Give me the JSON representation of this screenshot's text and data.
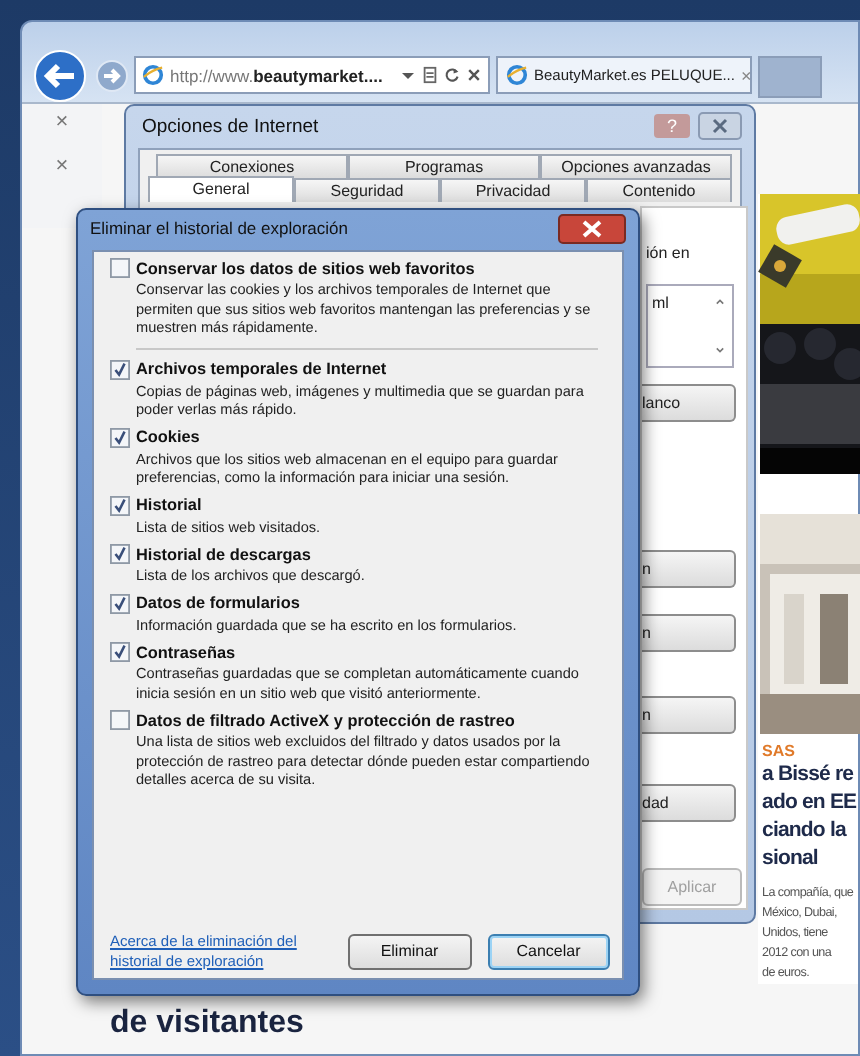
{
  "browser": {
    "address": "http://www.**beautymarket....**",
    "tab": {
      "label": "BeautyMarket.es PELUQUE...",
      "close": "×"
    },
    "side_marks": [
      "×",
      "×"
    ]
  },
  "options_dialog": {
    "title": "Opciones de Internet",
    "help": "?",
    "tab_rows": [
      [
        {
          "label": "Conexiones",
          "selected": false
        },
        {
          "label": "Programas",
          "selected": false
        },
        {
          "label": "Opciones avanzadas",
          "selected": false
        }
      ],
      [
        {
          "label": "General",
          "selected": true
        },
        {
          "label": "Seguridad",
          "selected": false
        },
        {
          "label": "Privacidad",
          "selected": false
        },
        {
          "label": "Contenido",
          "selected": false
        }
      ]
    ],
    "fragment_text": "ión en",
    "list_fragment": "ml",
    "button_fragments": [
      "lanco",
      "n",
      "n",
      "n",
      "dad"
    ],
    "apply": {
      "label": "Aplicar",
      "disabled": true
    }
  },
  "delete_dialog": {
    "title": "Eliminar el historial de exploración",
    "items": [
      {
        "label": "Conservar los datos de sitios web favoritos",
        "description": "Conservar las cookies y los archivos temporales de Internet que permiten que sus sitios web favoritos mantengan las preferencias y se muestren más rápidamente.",
        "checked": false
      },
      {
        "label": "Archivos temporales de Internet",
        "description": "Copias de páginas web, imágenes y multimedia que se guardan para poder verlas más rápido.",
        "checked": true
      },
      {
        "label": "Cookies",
        "description": "Archivos que los sitios web almacenan en el equipo para guardar preferencias, como la información para iniciar una sesión.",
        "checked": true
      },
      {
        "label": "Historial",
        "description": "Lista de sitios web visitados.",
        "checked": true
      },
      {
        "label": "Historial de descargas",
        "description": "Lista de los archivos que descargó.",
        "checked": true
      },
      {
        "label": "Datos de formularios",
        "description": "Información guardada que se ha escrito en los formularios.",
        "checked": true
      },
      {
        "label": "Contraseñas",
        "description": "Contraseñas guardadas que se completan automáticamente cuando inicia sesión en un sitio web que visitó anteriormente.",
        "checked": true
      },
      {
        "label": "Datos de filtrado ActiveX y protección de rastreo",
        "description": "Una lista de sitios web excluidos del filtrado y datos usados por la protección de rastreo para detectar dónde pueden estar compartiendo detalles acerca de su visita.",
        "checked": false
      }
    ],
    "link": "Acerca de la eliminación del historial de exploración",
    "buttons": [
      {
        "label": "Eliminar",
        "focused": false
      },
      {
        "label": "Cancelar",
        "focused": true
      }
    ]
  },
  "web_page": {
    "category": "SAS",
    "headline": [
      "a Bissé re",
      "ado en EE",
      "ciando la",
      "sional"
    ],
    "summary": [
      "La compañía, que",
      "México, Dubai,",
      "Unidos, tiene",
      "2012 con una",
      "de euros."
    ],
    "bottom_heading": "de visitantes"
  }
}
